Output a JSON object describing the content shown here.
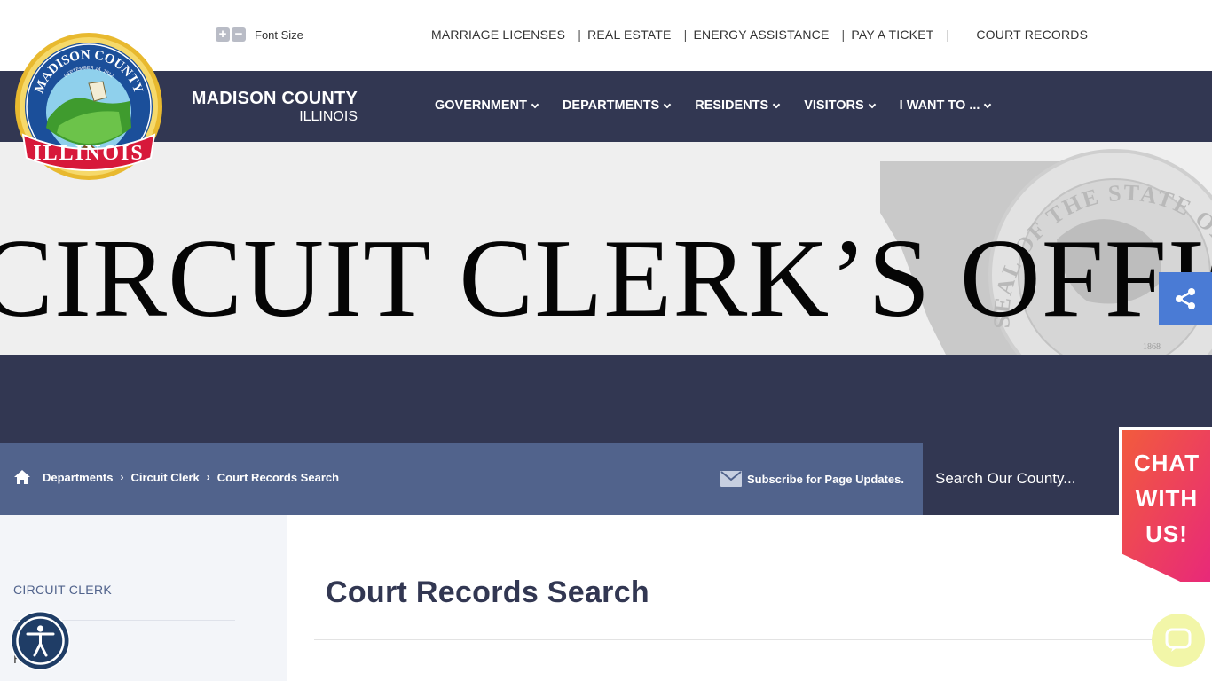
{
  "utility": {
    "font_size_label": "Font Size",
    "plus_symbol": "+",
    "minus_symbol": "−",
    "quick_links": [
      "MARRIAGE LICENSES",
      "REAL ESTATE",
      "ENERGY ASSISTANCE",
      "PAY A TICKET",
      "COURT RECORDS"
    ],
    "separator": "|"
  },
  "brand": {
    "name": "MADISON COUNTY",
    "state": "ILLINOIS",
    "seal_top_text": "MADISON COUNTY",
    "seal_date_text": "SEPTEMBER 14, 1812",
    "seal_bottom_text": "ILLINOIS"
  },
  "nav": {
    "items": [
      "GOVERNMENT",
      "DEPARTMENTS",
      "RESIDENTS",
      "VISITORS",
      "I WANT TO ..."
    ]
  },
  "hero": {
    "title": "CIRCUIT CLERK’S OFFICE",
    "seal_text": "SEAL OF THE STATE OF",
    "seal_year": "1868"
  },
  "breadcrumb": {
    "items": [
      "Departments",
      "Circuit Clerk",
      "Court Records Search"
    ],
    "separator": "›"
  },
  "subscribe": {
    "label": "Subscribe for Page Updates."
  },
  "search": {
    "placeholder": "Search Our County..."
  },
  "sidebar": {
    "heading": "CIRCUIT CLERK",
    "first_item": "Home"
  },
  "main": {
    "title": "Court Records Search"
  },
  "chat": {
    "lines": [
      "CHAT",
      "WITH",
      "US!"
    ]
  },
  "colors": {
    "navy": "#323752",
    "breadcrumb_blue": "#51638c",
    "share_blue": "#4a7bd5",
    "chat_gradient_start": "#f25c3c",
    "chat_gradient_end": "#e8287a",
    "livechat_bg": "#f2f6a8"
  },
  "icons": [
    "plus-icon",
    "minus-icon",
    "chevron-down-icon",
    "home-icon",
    "mail-icon",
    "share-icon",
    "accessibility-icon",
    "chat-bubble-icon"
  ]
}
